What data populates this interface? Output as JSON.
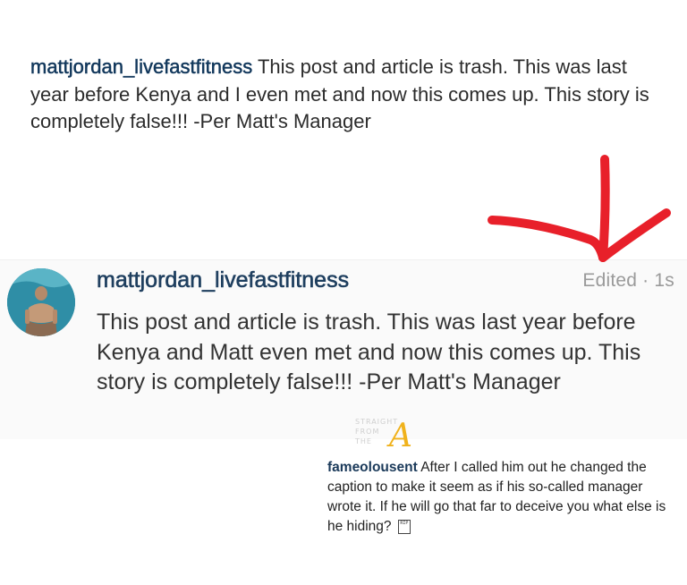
{
  "original_comment": {
    "username": "mattjordan_livefastfitness",
    "text": "This post and article is trash. This was last year before Kenya and I even met and now this comes up. This story is completely false!!! -Per Matt's Manager"
  },
  "edited_comment": {
    "username": "mattjordan_livefastfitness",
    "status": "Edited · 1s",
    "text": "This post and article is trash. This was last year before Kenya and Matt even met and now this comes up. This story is completely false!!! -Per Matt's Manager"
  },
  "watermark": {
    "text": "STRAIGHT FROM THE",
    "logo": "A"
  },
  "reply_comment": {
    "username": "fameolousent",
    "text": "After I called him out he changed the caption to make it seem as if his so-called manager wrote it. If he will go that far to deceive you what else is he hiding?",
    "emoji": "RIP"
  },
  "colors": {
    "username": "#12385c",
    "edited": "#9a9a9a",
    "arrow": "#e8202a",
    "panel_mid": "#fafafa"
  },
  "icons": [
    "avatar-photo",
    "red-arrow",
    "rip-emoji-icon",
    "watermark-logo"
  ]
}
